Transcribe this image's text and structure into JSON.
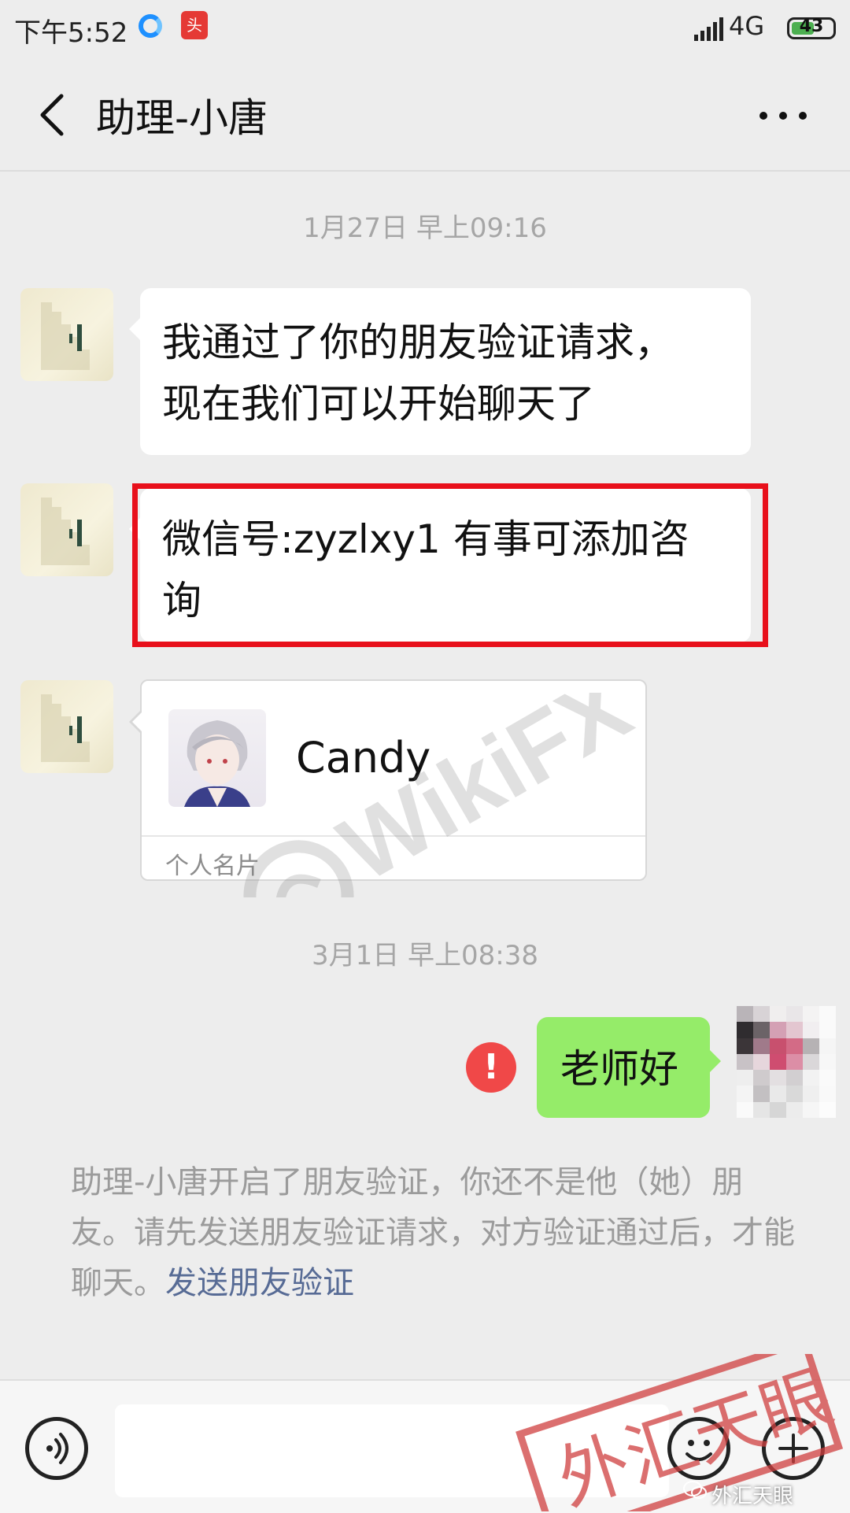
{
  "status_bar": {
    "time": "下午5:52",
    "network": "4G",
    "battery": "43",
    "app2_label": "头"
  },
  "header": {
    "title": "助理-小唐",
    "back_icon": "chevron-left-icon",
    "more_icon": "more-horizontal-icon"
  },
  "chat": {
    "timestamp_1": "1月27日 早上09:16",
    "messages": [
      {
        "line1": "我通过了你的朋友验证请求，",
        "line2": "现在我们可以开始聊天了"
      },
      {
        "line1": "微信号:zyzlxy1  有事可添加咨",
        "line2": "询"
      }
    ],
    "card": {
      "name": "Candy",
      "label": "个人名片"
    },
    "timestamp_2": "3月1日 早上08:38",
    "my_message": "老师好",
    "error_mark": "!",
    "system_notice": "助理-小唐开启了朋友验证，你还不是他（她）朋友。请先发送朋友验证请求，对方验证通过后，才能聊天。",
    "system_link": "发送朋友验证"
  },
  "input_bar": {
    "voice_icon": "voice-icon",
    "emoji_icon": "emoji-icon",
    "plus_icon": "plus-icon"
  },
  "overlays": {
    "watermark": "WikiFX",
    "stamp": "外汇天眼",
    "source_tag": "外汇天眼"
  },
  "colors": {
    "background": "#ededed",
    "bubble_self": "#95ec69",
    "highlight_border": "#e8101b",
    "link": "#576b95",
    "error": "#f04848"
  }
}
